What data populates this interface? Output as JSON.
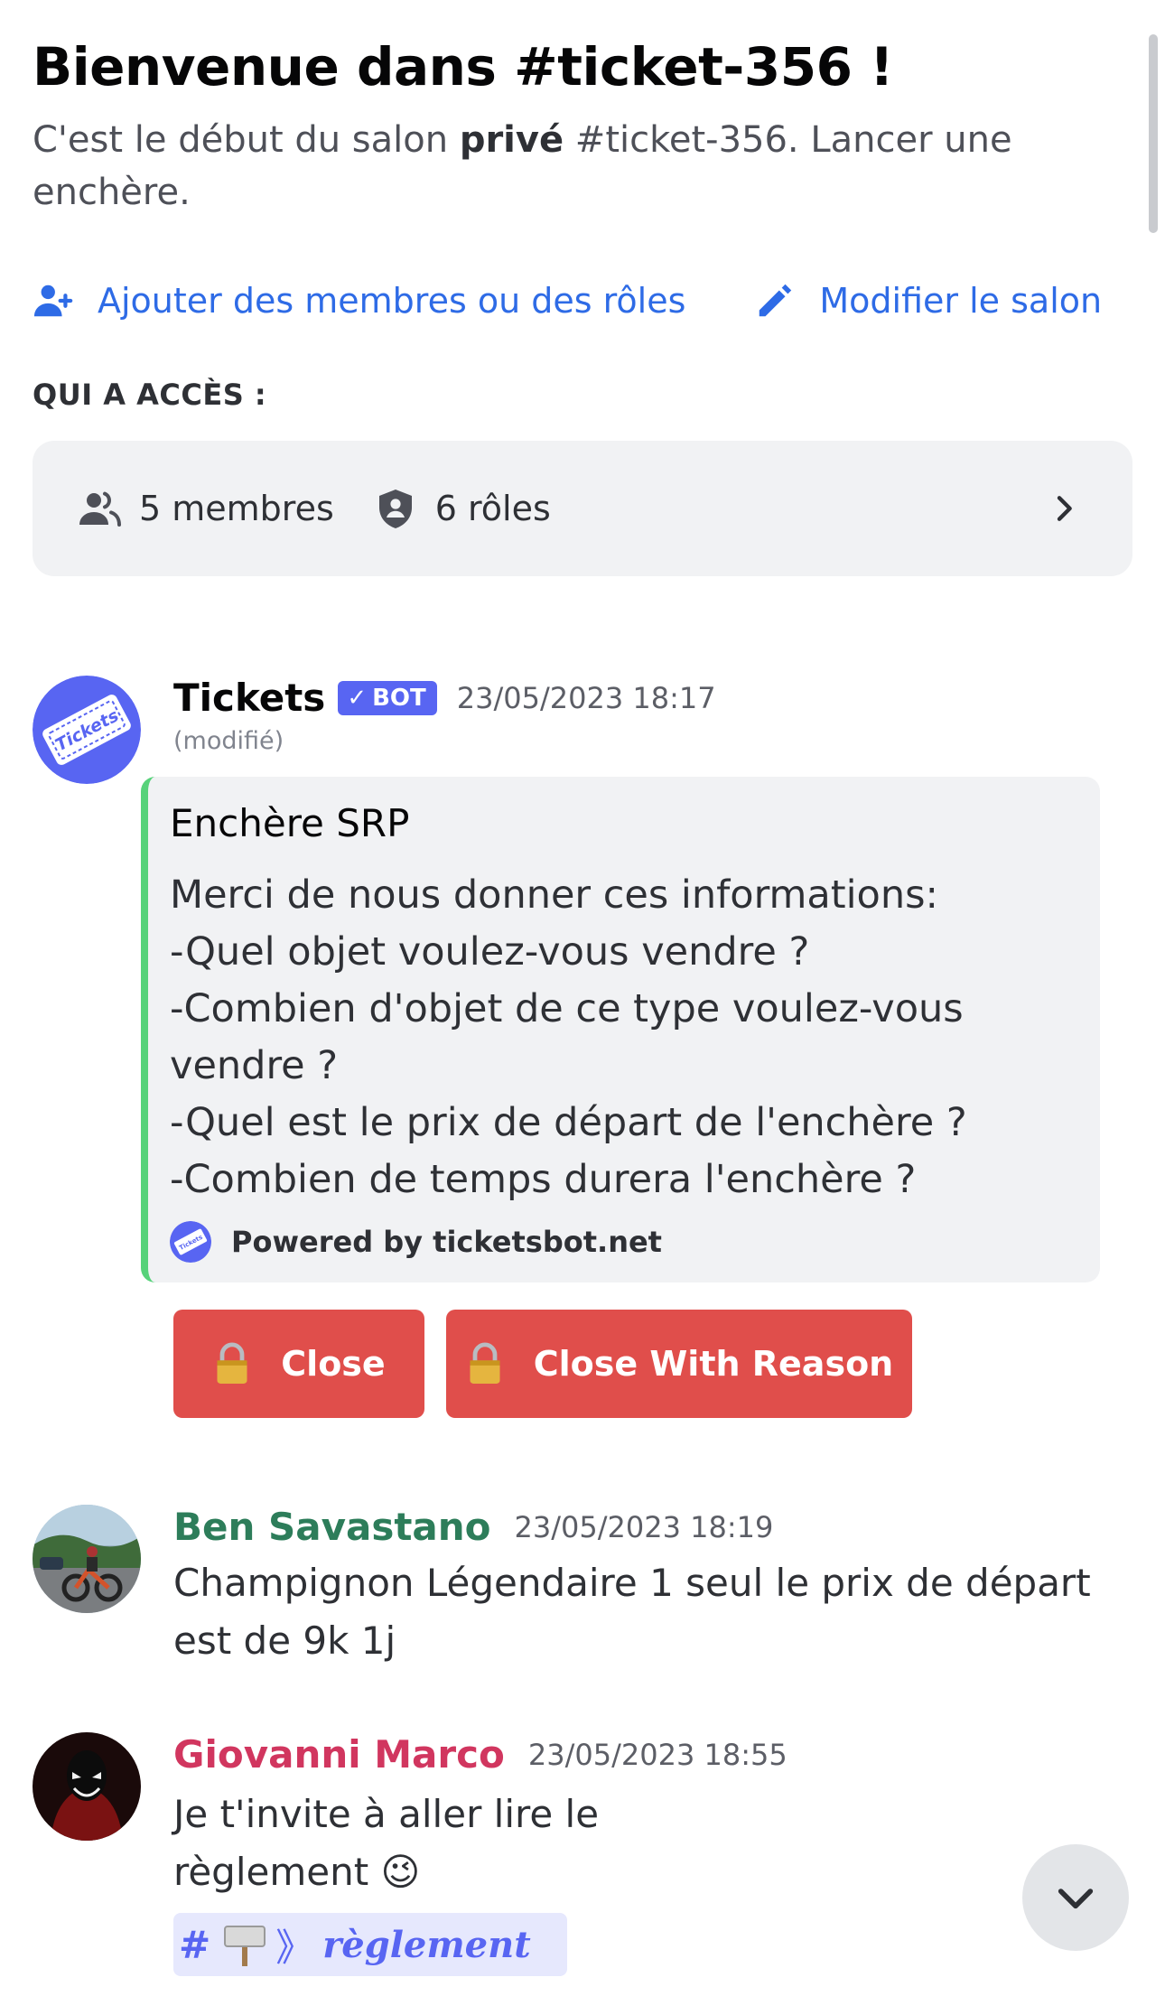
{
  "header": {
    "title": "Bienvenue dans #ticket-356 !",
    "subtitle_prefix": "C'est le début du salon ",
    "subtitle_bold": "privé",
    "subtitle_suffix": " #ticket-356. Lancer une enchère."
  },
  "actions": {
    "add_members": "Ajouter des membres ou des rôles",
    "edit_channel": "Modifier le salon"
  },
  "access": {
    "label": "QUI A ACCÈS :",
    "members": "5 membres",
    "roles": "6 rôles"
  },
  "messages": [
    {
      "author": "Tickets",
      "badge": "BOT",
      "timestamp": "23/05/2023 18:17",
      "edited": "(modifié)",
      "embed": {
        "title": "Enchère SRP",
        "description": "Merci de nous donner ces informations:\n-Quel objet voulez-vous vendre ?\n-Combien d'objet de ce type voulez-vous vendre ?\n-Quel est le prix de départ de l'enchère ?\n-Combien de temps durera l'enchère ?",
        "footer": "Powered by ticketsbot.net"
      },
      "buttons": [
        "Close",
        "Close With Reason"
      ]
    },
    {
      "author": "Ben Savastano",
      "author_color": "#2d7d5a",
      "timestamp": "23/05/2023 18:19",
      "text": "Champignon Légendaire 1 seul le prix de départ est de 9k 1j"
    },
    {
      "author": "Giovanni Marco",
      "author_color": "#d1365f",
      "timestamp": "23/05/2023 18:55",
      "text": "Je t'invite à aller lire le règlement 😉",
      "mention": {
        "hash": "#",
        "arrows": "》",
        "channel": "règlement"
      }
    }
  ],
  "colors": {
    "link_blue": "#2e6be6",
    "blurple": "#5865f2",
    "danger": "#e04e4b",
    "embed_bar": "#57d27a"
  },
  "icons": [
    "add-members-icon",
    "pencil-icon",
    "members-icon",
    "shield-icon",
    "chevron-right-icon",
    "lock-icon",
    "signpost-icon",
    "chevron-down-icon"
  ]
}
